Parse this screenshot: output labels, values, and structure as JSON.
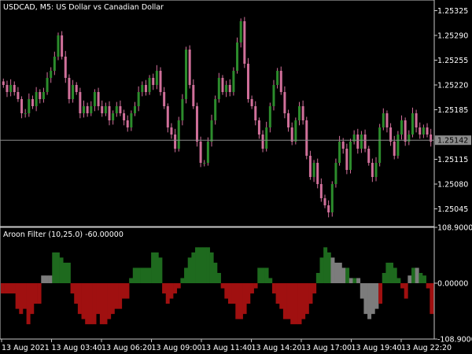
{
  "colors": {
    "background": "#000000",
    "grid_border": "#c8c8c8",
    "bull_candle": "#2c8c2c",
    "bear_candle": "#d0709a",
    "wick": "#d0709a",
    "price_line": "#8c8c8c",
    "price_tag_bg": "#8c8c8c",
    "aroon_up": "#1e6a1e",
    "aroon_down": "#a01010",
    "aroon_neutral": "#7c7c7c"
  },
  "chart_data": [
    {
      "type": "candlestick",
      "title": "USDCAD, M5:  US Dollar vs Canadian Dollar",
      "symbol": "USDCAD",
      "timeframe": "M5",
      "description": "US Dollar vs Canadian Dollar",
      "y_ticks": [
        "1.25325",
        "1.25290",
        "1.25255",
        "1.25220",
        "1.25185",
        "1.25115",
        "1.25080",
        "1.25045"
      ],
      "ylim": [
        1.2502,
        1.2534
      ],
      "current_price": "1.25142",
      "current_price_value": 1.25142,
      "close": [
        1.2522,
        1.2521,
        1.2522,
        1.2521,
        1.252,
        1.2518,
        1.2518,
        1.252,
        1.2519,
        1.2521,
        1.252,
        1.2521,
        1.2523,
        1.2524,
        1.2526,
        1.2529,
        1.2526,
        1.2523,
        1.252,
        1.2522,
        1.2521,
        1.2518,
        1.2519,
        1.2518,
        1.2519,
        1.2521,
        1.2519,
        1.2518,
        1.2519,
        1.2517,
        1.2518,
        1.2519,
        1.2518,
        1.2517,
        1.2516,
        1.2518,
        1.2519,
        1.2521,
        1.2522,
        1.2521,
        1.2523,
        1.2522,
        1.2524,
        1.2521,
        1.2519,
        1.2516,
        1.2515,
        1.2513,
        1.2517,
        1.252,
        1.2527,
        1.2522,
        1.2519,
        1.2514,
        1.2511,
        1.2511,
        1.2514,
        1.2517,
        1.252,
        1.2523,
        1.2521,
        1.2522,
        1.2521,
        1.2524,
        1.2528,
        1.2531,
        1.2525,
        1.252,
        1.2519,
        1.2517,
        1.2515,
        1.2513,
        1.2516,
        1.2519,
        1.2522,
        1.2524,
        1.2521,
        1.2518,
        1.2516,
        1.2514,
        1.2517,
        1.2519,
        1.2517,
        1.2512,
        1.2509,
        1.2511,
        1.2508,
        1.2506,
        1.2505,
        1.2504,
        1.2508,
        1.2511,
        1.2514,
        1.2513,
        1.251,
        1.2514,
        1.2515,
        1.2513,
        1.2515,
        1.2513,
        1.2511,
        1.2509,
        1.2511,
        1.2516,
        1.2518,
        1.2516,
        1.2514,
        1.2512,
        1.2515,
        1.2517,
        1.2514,
        1.2515,
        1.2518,
        1.2516,
        1.2515,
        1.2516,
        1.2515,
        1.2514
      ]
    },
    {
      "type": "bar",
      "title": "Aroon Filter (10,25.0) -60.00000",
      "indicator": "Aroon Filter",
      "parameters": "(10,25.0)",
      "last_value": "-60.00000",
      "y_ticks": [
        "108.90000",
        "0.00000",
        "-108.90000"
      ],
      "ylim": [
        -108.9,
        108.9
      ],
      "values": [
        -20,
        -20,
        -20,
        -20,
        -50,
        -60,
        -50,
        -80,
        -60,
        -40,
        -40,
        15,
        15,
        15,
        60,
        60,
        50,
        40,
        40,
        -20,
        -40,
        -60,
        -70,
        -80,
        -80,
        -80,
        -60,
        -80,
        -80,
        -70,
        -60,
        -50,
        -50,
        -30,
        -30,
        10,
        30,
        30,
        30,
        30,
        30,
        60,
        60,
        50,
        -20,
        -40,
        -30,
        -20,
        -10,
        10,
        30,
        50,
        60,
        70,
        70,
        70,
        70,
        60,
        40,
        20,
        -10,
        -30,
        -40,
        -40,
        -70,
        -70,
        -60,
        -40,
        -20,
        -10,
        30,
        30,
        30,
        10,
        -20,
        -40,
        -50,
        -70,
        -70,
        -80,
        -80,
        -80,
        -70,
        -60,
        -40,
        -20,
        20,
        50,
        70,
        60,
        50,
        40,
        40,
        30,
        30,
        10,
        10,
        10,
        -30,
        -60,
        -70,
        -60,
        -50,
        -40,
        20,
        40,
        40,
        30,
        10,
        -10,
        -30,
        15,
        30,
        30,
        20,
        15,
        -10,
        -60
      ],
      "neutral_indices": [
        11,
        12,
        13,
        90,
        91,
        92,
        93,
        95,
        97,
        98,
        99,
        100,
        101,
        102,
        111,
        113
      ]
    }
  ],
  "x_axis": {
    "labels": [
      "13 Aug 2021",
      "13 Aug 03:40",
      "13 Aug 06:20",
      "13 Aug 09:00",
      "13 Aug 11:40",
      "13 Aug 14:20",
      "13 Aug 17:00",
      "13 Aug 19:40",
      "13 Aug 22:20"
    ]
  }
}
